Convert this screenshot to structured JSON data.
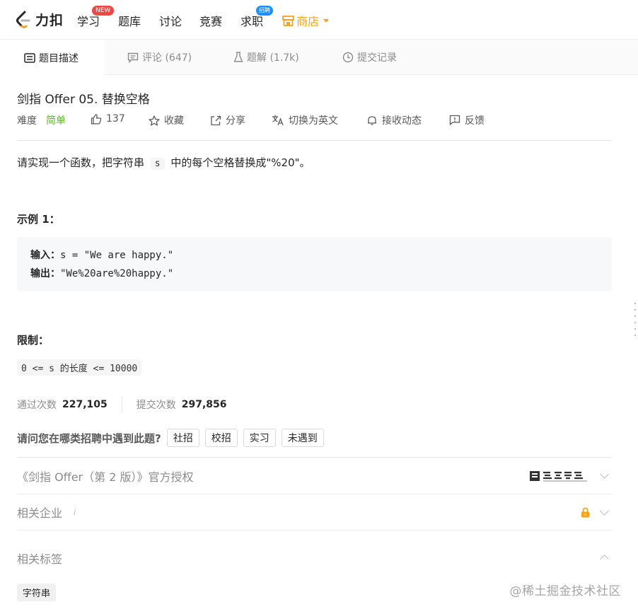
{
  "nav": {
    "brand": "力扣",
    "items": [
      {
        "label": "学习",
        "badge": "NEW"
      },
      {
        "label": "题库"
      },
      {
        "label": "讨论"
      },
      {
        "label": "竞赛"
      },
      {
        "label": "求职",
        "badge": "招聘"
      }
    ],
    "shop": "商店"
  },
  "tabs": [
    {
      "label": "题目描述",
      "icon": "description-icon",
      "active": true
    },
    {
      "label": "评论 (647)",
      "icon": "comment-icon"
    },
    {
      "label": "题解 (1.7k)",
      "icon": "flask-icon"
    },
    {
      "label": "提交记录",
      "icon": "clock-icon"
    }
  ],
  "problem": {
    "title": "剑指 Offer 05. 替换空格",
    "difficulty_label": "难度",
    "difficulty": "简单",
    "likes": "137",
    "favorite": "收藏",
    "share": "分享",
    "switch_lang": "切换为英文",
    "subscribe": "接收动态",
    "feedback": "反馈",
    "desc_before": "请实现一个函数，把字符串 ",
    "desc_code": "s",
    "desc_after": " 中的每个空格替换成\"%20\"。",
    "example_heading": "示例 1：",
    "input_label": "输入：",
    "input_value": "s = \"We are happy.\"",
    "output_label": "输出：",
    "output_value": "\"We%20are%20happy.\"",
    "limit_heading": "限制：",
    "limit_code": "0 <= s 的长度 <= 10000",
    "accepted_label": "通过次数",
    "accepted": "227,105",
    "submissions_label": "提交次数",
    "submissions": "297,856",
    "ask": "请问您在哪类招聘中遇到此题?",
    "ask_options": [
      "社招",
      "校招",
      "实习",
      "未遇到"
    ],
    "book": "《剑指 Offer（第 2 版）》官方授权",
    "companies": "相关企业",
    "companies_info": "i",
    "tags_heading": "相关标签",
    "tags": [
      "字符串"
    ]
  },
  "watermark": "@稀土掘金技术社区",
  "colors": {
    "accent": "#ffa116",
    "easy": "#5ab726",
    "new_badge": "#ef4743",
    "hire_badge": "#1a90ff"
  }
}
